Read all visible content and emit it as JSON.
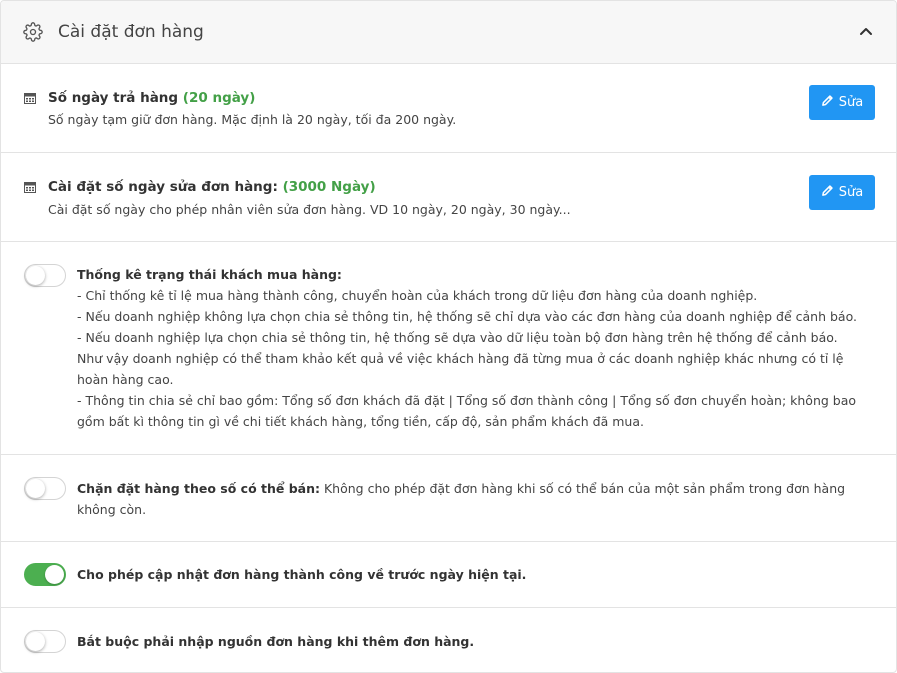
{
  "panel": {
    "title": "Cài đặt đơn hàng",
    "header_icon": "gear-icon",
    "collapse_icon": "chevron-up-icon"
  },
  "return_days": {
    "title": "Số ngày trả hàng",
    "value": "(20 ngày)",
    "description": "Số ngày tạm giữ đơn hàng. Mặc định là 20 ngày, tối đa 200 ngày.",
    "edit_label": "Sửa",
    "icon": "calendar-icon"
  },
  "edit_days": {
    "title": "Cài đặt số ngày sửa đơn hàng:",
    "value": "(3000 Ngày)",
    "description": "Cài đặt số ngày cho phép nhân viên sửa đơn hàng. VD 10 ngày, 20 ngày, 30 ngày...",
    "edit_label": "Sửa",
    "icon": "calendar-icon"
  },
  "customer_stats": {
    "enabled": false,
    "title": "Thống kê trạng thái khách mua hàng:",
    "lines": [
      "- Chỉ thống kê tỉ lệ mua hàng thành công, chuyển hoàn của khách trong dữ liệu đơn hàng của doanh nghiệp.",
      "- Nếu doanh nghiệp không lựa chọn chia sẻ thông tin, hệ thống sẽ chỉ dựa vào các đơn hàng của doanh nghiệp để cảnh báo.",
      "- Nếu doanh nghiệp lựa chọn chia sẻ thông tin, hệ thống sẽ dựa vào dữ liệu toàn bộ đơn hàng trên hệ thống để cảnh báo.",
      "Như vậy doanh nghiệp có thể tham khảo kết quả về việc khách hàng đã từng mua ở các doanh nghiệp khác nhưng có tỉ lệ",
      "hoàn hàng cao.",
      "- Thông tin chia sẻ chỉ bao gồm: Tổng số đơn khách đã đặt | Tổng số đơn thành công | Tổng số đơn chuyển hoàn; không bao",
      "gồm bất kì thông tin gì về chi tiết khách hàng, tổng tiền, cấp độ, sản phẩm khách đã mua."
    ]
  },
  "block_stock": {
    "enabled": false,
    "title": "Chặn đặt hàng theo số có thể bán:",
    "line1": " Không cho phép đặt đơn hàng khi số có thể bán của một sản phẩm trong đơn hàng",
    "line2": "không còn."
  },
  "allow_update": {
    "enabled": true,
    "title": "Cho phép cập nhật đơn hàng thành công về trước ngày hiện tại."
  },
  "require_source": {
    "enabled": false,
    "title": "Bắt buộc phải nhập nguồn đơn hàng khi thêm đơn hàng."
  },
  "colors": {
    "accent_blue": "#2196f3",
    "toggle_on": "#4caf50",
    "value_green": "#43a047"
  }
}
